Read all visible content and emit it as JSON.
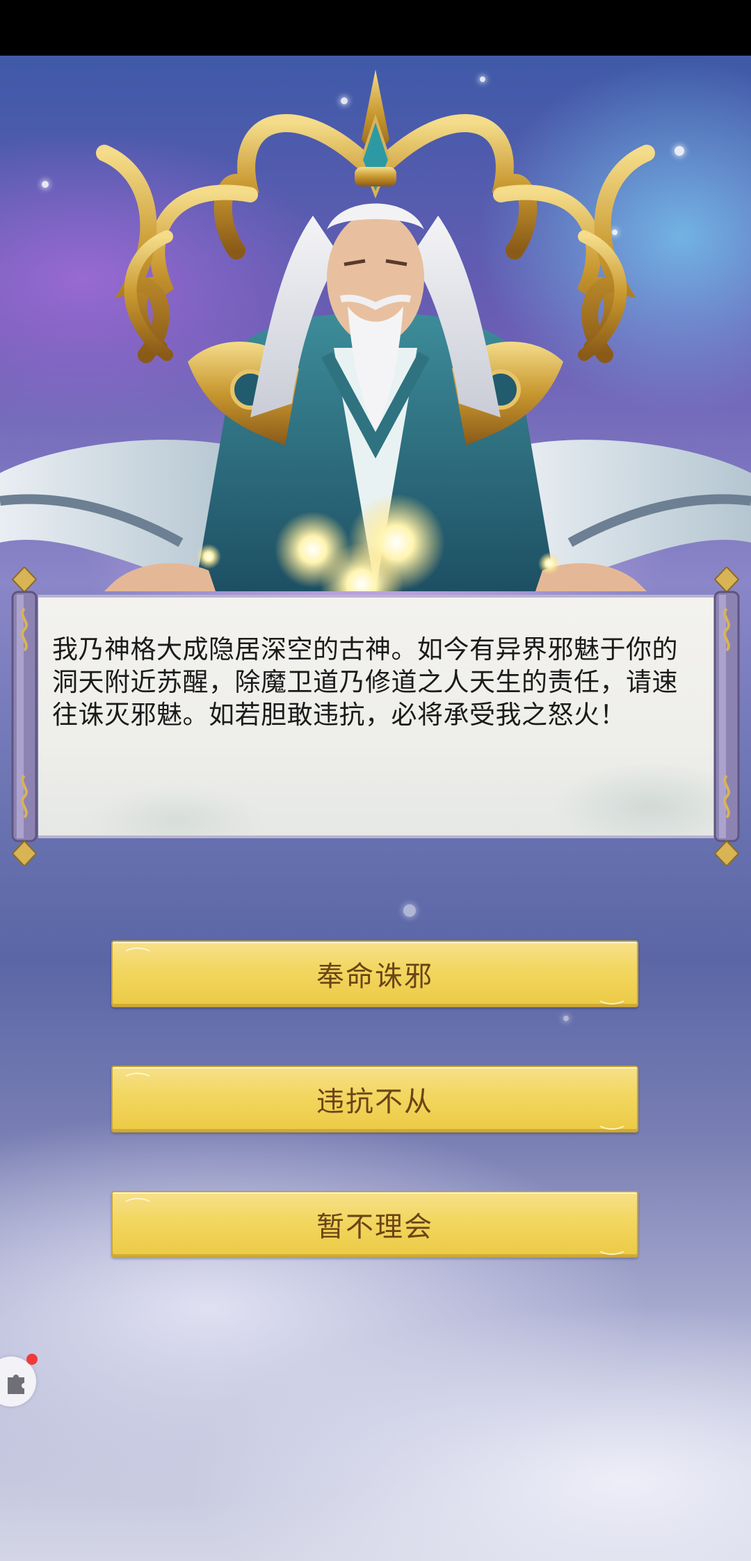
{
  "dialog": {
    "text": "我乃神格大成隐居深空的古神。如今有异界邪魅于你的洞天附近苏醒，除魔卫道乃修道之人天生的责任，请速往诛灭邪魅。如若胆敢违抗，必将承受我之怒火！"
  },
  "choices": [
    {
      "label": "奉命诛邪"
    },
    {
      "label": "违抗不从"
    },
    {
      "label": "暂不理会"
    }
  ],
  "colors": {
    "button_gold": "#f2d65f",
    "button_text": "#6b4415",
    "notification_dot": "#f03a3a"
  },
  "icons": {
    "floating_assistant": "puzzle-icon",
    "notification": "red-dot"
  }
}
